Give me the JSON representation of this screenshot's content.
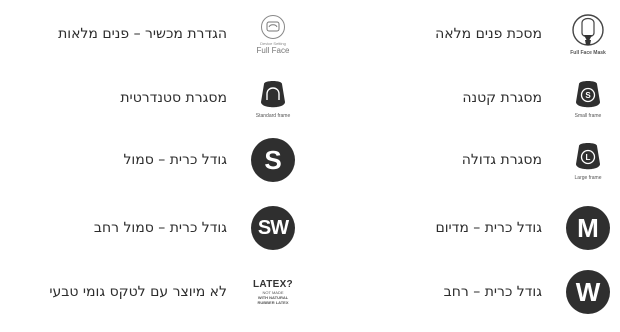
{
  "items": {
    "full_face_mask": {
      "label": "מסכת פנים מלאה",
      "caption": "Full Face Mask",
      "icon": "full-face-mask-icon"
    },
    "small_frame": {
      "label": "מסגרת קטנה",
      "caption": "Small frame",
      "icon_letter": "S"
    },
    "large_frame": {
      "label": "מסגרת גדולה",
      "caption": "Large frame",
      "icon_letter": "L"
    },
    "cushion_medium": {
      "label": "גודל כרית – מדיום",
      "icon_letter": "M"
    },
    "cushion_wide": {
      "label": "גודל כרית – רחב",
      "icon_letter": "W"
    },
    "device_setting": {
      "label": "הגדרת מכשיר – פנים מלאות",
      "small": "Device Setting",
      "big": "Full Face"
    },
    "standard_frame": {
      "label": "מסגרת סטנדרטית",
      "caption": "Standard frame"
    },
    "cushion_small": {
      "label": "גודל כרית – סמול",
      "icon_letter": "S"
    },
    "cushion_small_wide": {
      "label": "גודל כרית – סמול רחב",
      "icon_letter": "SW"
    },
    "latex": {
      "label": "לא מיוצר עם לטקס גומי טבעי",
      "title": "LATEX?",
      "line1": "NOT MADE",
      "line2": "WITH NATURAL",
      "line3": "RUBBER LATEX"
    }
  },
  "colors": {
    "icon_dark": "#2f2f2f",
    "text": "#2d2d2d"
  }
}
